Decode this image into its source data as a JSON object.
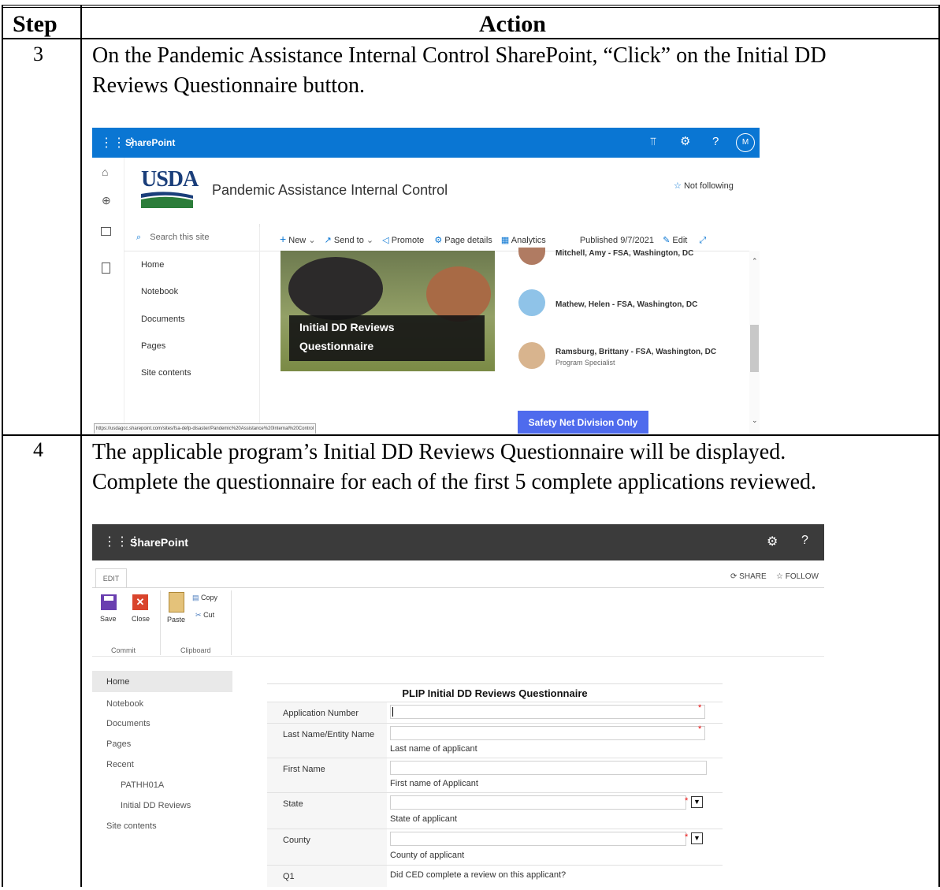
{
  "table": {
    "headers": {
      "step": "Step",
      "action": "Action"
    },
    "rows": [
      {
        "step": "3",
        "text_line1": "On the Pandemic Assistance Internal Control SharePoint, “Click” on the Initial DD",
        "text_line2": "Reviews Questionnaire button."
      },
      {
        "step": "4",
        "text_line1": "The applicable program’s Initial DD Reviews Questionnaire will be displayed.",
        "text_line2": "Complete the questionnaire for each of the first 5 complete applications reviewed."
      }
    ]
  },
  "shot1": {
    "app_name": "SharePoint",
    "avatar_initial": "M",
    "logo_text": "USDA",
    "site_title": "Pandemic Assistance Internal Control",
    "follow_label": "Not following",
    "search_placeholder": "Search this site",
    "commands": {
      "new": "New",
      "send_to": "Send to",
      "promote": "Promote",
      "page_details": "Page details",
      "analytics": "Analytics",
      "published": "Published 9/7/2021",
      "edit": "Edit"
    },
    "nav_items": [
      "Home",
      "Notebook",
      "Documents",
      "Pages",
      "Site contents"
    ],
    "hero_caption_line1": "Initial DD Reviews",
    "hero_caption_line2": "Questionnaire",
    "people": [
      {
        "name": "Mitchell, Amy - FSA, Washington, DC",
        "role": ""
      },
      {
        "name": "Mathew, Helen - FSA, Washington, DC",
        "role": ""
      },
      {
        "name": "Ramsburg, Brittany - FSA, Washington, DC",
        "role": "Program Specialist"
      }
    ],
    "safety_button": "Safety Net Division Only",
    "status_url": "https://usdagcc.sharepoint.com/sites/fsa-defp-disaster/Pandemic%20Assistance%20Internal%20Control",
    "colors": {
      "suite_bar": "#0a76d3",
      "button": "#4f6bed"
    }
  },
  "shot2": {
    "app_name": "SharePoint",
    "tab_edit": "EDIT",
    "share_label": "SHARE",
    "follow_label": "FOLLOW",
    "ribbon": {
      "save": "Save",
      "close": "Close",
      "paste": "Paste",
      "copy": "Copy",
      "cut": "Cut",
      "group_commit": "Commit",
      "group_clipboard": "Clipboard"
    },
    "nav": {
      "home": "Home",
      "notebook": "Notebook",
      "documents": "Documents",
      "pages": "Pages",
      "recent": "Recent",
      "recent_1": "PATHH01A",
      "recent_2": "Initial DD Reviews",
      "site_contents": "Site contents"
    },
    "form_title": "PLIP Initial DD Reviews Questionnaire",
    "fields": {
      "app_number": "Application Number",
      "last_name": "Last Name/Entity Name",
      "last_name_hint": "Last name of applicant",
      "first_name": "First Name",
      "first_name_hint": "First name of Applicant",
      "state": "State",
      "state_hint": "State of applicant",
      "county": "County",
      "county_hint": "County of applicant",
      "q1": "Q1",
      "q1_text": "Did CED complete a review on this applicant?"
    },
    "colors": {
      "suite_bar": "#3b3b3b"
    }
  }
}
